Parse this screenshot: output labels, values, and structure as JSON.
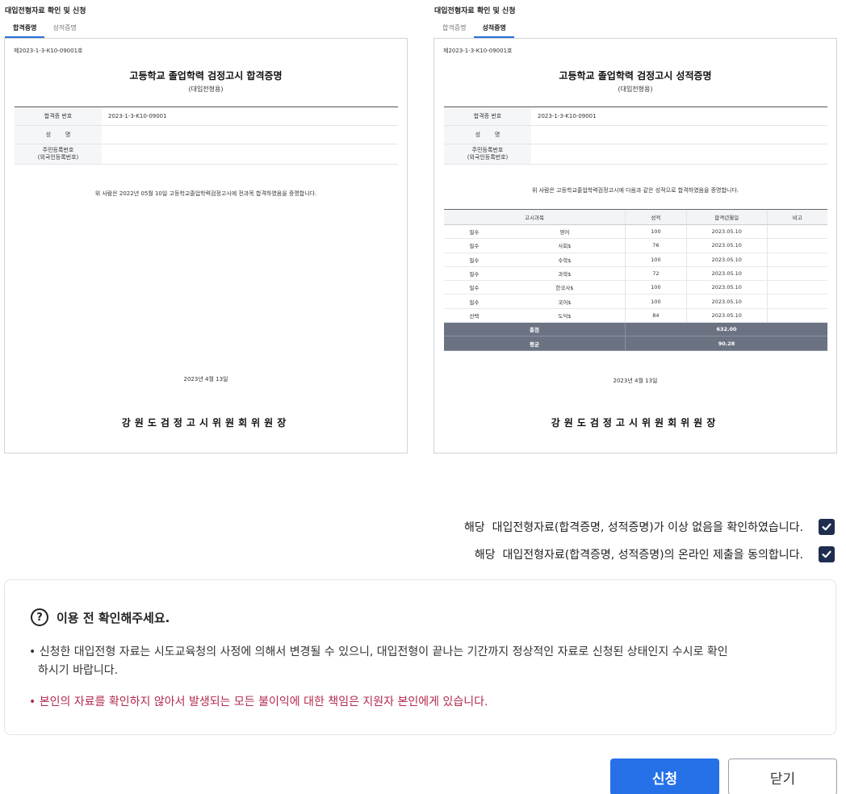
{
  "left_panel": {
    "section_title": "대입전형자료 확인 및 신청",
    "tabs": [
      "합격증명",
      "성적증명"
    ],
    "active_tab": 0,
    "doc": {
      "number": "제2023-1-3-K10-09001호",
      "title": "고등학교 졸업학력 검정고시 합격증명",
      "subtitle": "(대입전형용)",
      "info": {
        "cert_no_label": "합격증 번호",
        "cert_no_value": "2023-1-3-K10-09001",
        "name_label": "성        명",
        "name_value": "",
        "rrn_label_line1": "주민등록번호",
        "rrn_label_line2": "(외국인등록번호)",
        "rrn_value": ""
      },
      "statement": "위 사람은 2022년 05월 10일 고등학교졸업학력검정고시에 전과목 합격하였음을 증명합니다.",
      "date": "2023년 4월 13일",
      "signature": "강원도검정고시위원회위원장"
    }
  },
  "right_panel": {
    "section_title": "대입전형자료 확인 및 신청",
    "tabs": [
      "합격증명",
      "성적증명"
    ],
    "active_tab": 1,
    "doc": {
      "number": "제2023-1-3-K10-09001호",
      "title": "고등학교 졸업학력 검정고시 성적증명",
      "subtitle": "(대입전형용)",
      "info": {
        "cert_no_label": "합격증 번호",
        "cert_no_value": "2023-1-3-K10-09001",
        "name_label": "성        명",
        "name_value": "",
        "rrn_label_line1": "주민등록번호",
        "rrn_label_line2": "(외국인등록번호)",
        "rrn_value": ""
      },
      "statement": "위 사람은 고등학교졸업학력검정고시에 다음과 같은 성적으로 합격하였음을 증명합니다.",
      "table": {
        "headers": [
          "고시과목",
          "성적",
          "합격년월일",
          "비고"
        ],
        "rows": [
          {
            "type": "필수",
            "subject": "영어",
            "score": "100",
            "date": "2023.05.10",
            "note": ""
          },
          {
            "type": "필수",
            "subject": "사회$",
            "score": "76",
            "date": "2023.05.10",
            "note": ""
          },
          {
            "type": "필수",
            "subject": "수학$",
            "score": "100",
            "date": "2023.05.10",
            "note": ""
          },
          {
            "type": "필수",
            "subject": "과학$",
            "score": "72",
            "date": "2023.05.10",
            "note": ""
          },
          {
            "type": "필수",
            "subject": "한국사$",
            "score": "100",
            "date": "2023.05.10",
            "note": ""
          },
          {
            "type": "필수",
            "subject": "국어$",
            "score": "100",
            "date": "2023.05.10",
            "note": ""
          },
          {
            "type": "선택",
            "subject": "도덕$",
            "score": "84",
            "date": "2023.05.10",
            "note": ""
          }
        ],
        "total_label": "총점",
        "total_value": "632.00",
        "avg_label": "평균",
        "avg_value": "90.28"
      },
      "date": "2023년 4월 13일",
      "signature": "강원도검정고시위원회위원장"
    }
  },
  "confirmations": [
    {
      "text": "해당  대입전형자료(합격증명, 성적증명)가 이상 없음을 확인하였습니다.",
      "checked": true
    },
    {
      "text": "해당  대입전형자료(합격증명, 성적증명)의 온라인 제출을 동의합니다.",
      "checked": true
    }
  ],
  "notice": {
    "title": "이용 전 확인해주세요.",
    "icon": "question-circle-icon",
    "bullet1_line1": "• 신청한 대입전형 자료는 시도교육청의 사정에 의해서 변경될 수 있으니, 대입전형이 끝나는 기간까지 정상적인 자료로 신청된 상태인지 수시로 확인",
    "bullet1_line2": "하시기 바랍니다.",
    "bullet2": "• 본인의 자료를 확인하지 않아서 발생되는 모든 불이익에 대한 책임은 지원자 본인에게 있습니다.",
    "warning_color": "#b3294b"
  },
  "buttons": {
    "submit": "신청",
    "close": "닫기",
    "primary_color": "#2670e8"
  }
}
